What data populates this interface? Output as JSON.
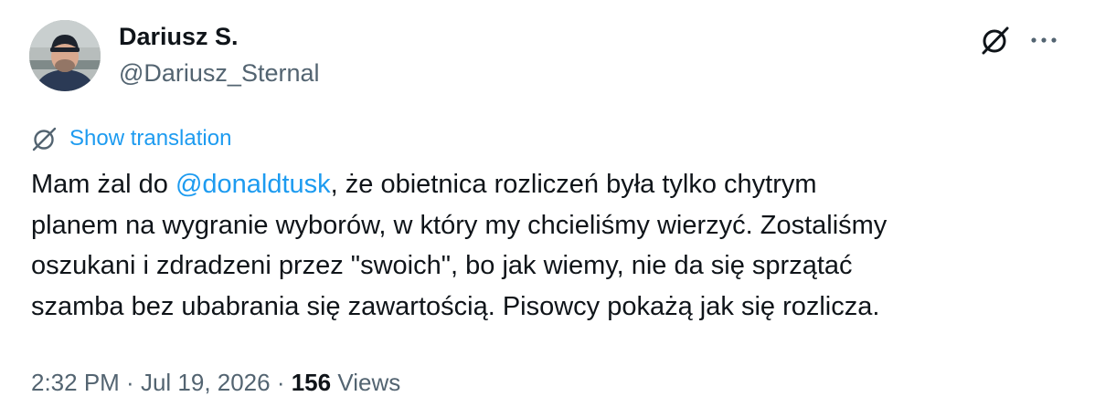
{
  "author": {
    "display_name": "Dariusz S.",
    "handle": "@Dariusz_Sternal"
  },
  "header": {
    "grok_icon": "grok-slash-icon",
    "more_icon": "ellipsis-icon"
  },
  "translation": {
    "icon": "globe-slash-icon",
    "label": "Show translation"
  },
  "tweet": {
    "lines": [
      {
        "before": "Mam żal do ",
        "mention": "@donaldtusk",
        "after": ", że obietnica rozliczeń była tylko chytrym"
      },
      {
        "text": "planem na wygranie wyborów, w który my chcieliśmy wierzyć. Zostaliśmy"
      },
      {
        "text": "oszukani i zdradzeni przez \"swoich\", bo jak wiemy, nie da się sprzątać"
      },
      {
        "text": "szamba bez ubabrania się zawartością. Pisowcy pokażą jak się rozlicza."
      }
    ]
  },
  "meta": {
    "time": "2:32 PM",
    "sep1": " · ",
    "date": "Jul 19, 2026",
    "sep2": " · ",
    "views_count": "156",
    "views_label": " Views"
  },
  "colors": {
    "link": "#1d9bf0",
    "secondary": "#536471",
    "text": "#0f1419"
  }
}
